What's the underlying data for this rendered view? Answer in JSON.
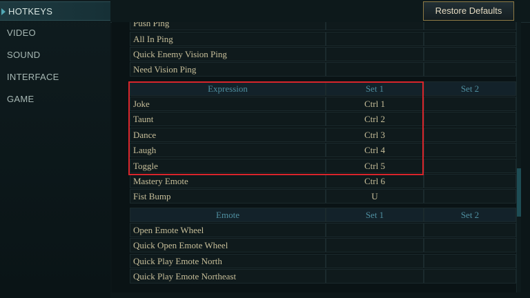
{
  "sidebar": {
    "items": [
      {
        "label": "HOTKEYS",
        "active": true
      },
      {
        "label": "VIDEO",
        "active": false
      },
      {
        "label": "SOUND",
        "active": false
      },
      {
        "label": "INTERFACE",
        "active": false
      },
      {
        "label": "GAME",
        "active": false
      }
    ]
  },
  "toolbar": {
    "restore_label": "Restore Defaults"
  },
  "colors": {
    "highlight": "#d9252b",
    "accent": "#52a8b4",
    "header_text": "#4f8fa0",
    "row_text": "#c8bf9a",
    "button_border": "#8e7a45"
  },
  "ping_section": {
    "rows": [
      {
        "name": "Push Ping",
        "set1": "",
        "set2": ""
      },
      {
        "name": "All In Ping",
        "set1": "",
        "set2": ""
      },
      {
        "name": "Quick Enemy Vision Ping",
        "set1": "",
        "set2": ""
      },
      {
        "name": "Need Vision Ping",
        "set1": "",
        "set2": ""
      }
    ]
  },
  "expression_section": {
    "header": {
      "name": "Expression",
      "set1": "Set 1",
      "set2": "Set 2"
    },
    "rows": [
      {
        "name": "Joke",
        "set1": "Ctrl 1",
        "set2": ""
      },
      {
        "name": "Taunt",
        "set1": "Ctrl 2",
        "set2": ""
      },
      {
        "name": "Dance",
        "set1": "Ctrl 3",
        "set2": ""
      },
      {
        "name": "Laugh",
        "set1": "Ctrl 4",
        "set2": ""
      },
      {
        "name": "Toggle",
        "set1": "Ctrl 5",
        "set2": ""
      },
      {
        "name": "Mastery Emote",
        "set1": "Ctrl 6",
        "set2": ""
      },
      {
        "name": "Fist Bump",
        "set1": "U",
        "set2": ""
      }
    ]
  },
  "emote_section": {
    "header": {
      "name": "Emote",
      "set1": "Set 1",
      "set2": "Set 2"
    },
    "rows": [
      {
        "name": "Open Emote Wheel",
        "set1": "",
        "set2": ""
      },
      {
        "name": "Quick Open Emote Wheel",
        "set1": "",
        "set2": ""
      },
      {
        "name": "Quick Play Emote North",
        "set1": "",
        "set2": ""
      },
      {
        "name": "Quick Play Emote Northeast",
        "set1": "",
        "set2": ""
      }
    ]
  }
}
